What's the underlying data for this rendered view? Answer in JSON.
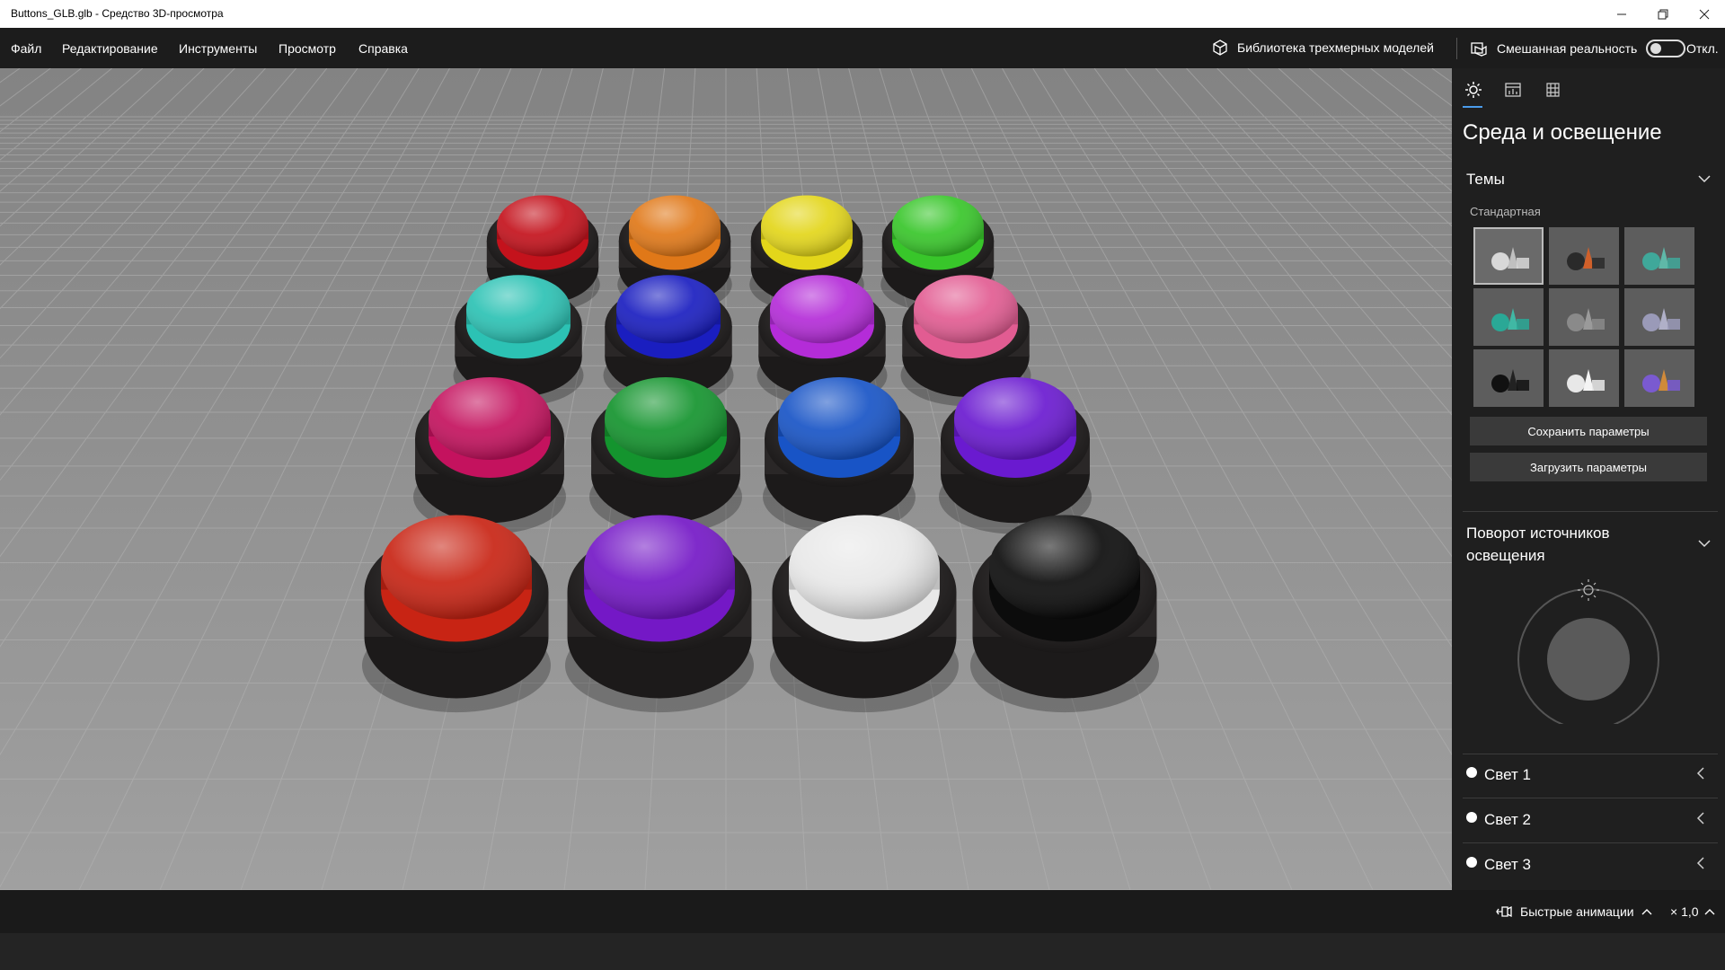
{
  "window": {
    "title": "Buttons_GLB.glb - Средство 3D-просмотра",
    "minimize_icon": "minimize-icon",
    "restore_icon": "restore-icon",
    "close_icon": "close-icon"
  },
  "menu": {
    "items": [
      "Файл",
      "Редактирование",
      "Инструменты",
      "Просмотр",
      "Справка"
    ],
    "library_label": "Библиотека трехмерных моделей",
    "mixed_reality_label": "Смешанная реальность",
    "mixed_reality_state": "Откл."
  },
  "panel": {
    "title": "Среда и освещение",
    "themes": {
      "heading": "Темы",
      "subheading": "Стандартная"
    },
    "save_button": "Сохранить параметры",
    "load_button": "Загрузить параметры",
    "rotation_heading": "Поворот источников освещения",
    "lights": [
      {
        "label": "Свет 1"
      },
      {
        "label": "Свет 2"
      },
      {
        "label": "Свет 3"
      }
    ]
  },
  "status": {
    "animations_label": "Быстрые анимации",
    "speed": "× 1,0"
  },
  "scene": {
    "buttons": [
      {
        "color": "#c4121c"
      },
      {
        "color": "#e07818"
      },
      {
        "color": "#e3d61a"
      },
      {
        "color": "#38c62a"
      },
      {
        "color": "#2cc2b4"
      },
      {
        "color": "#1a1ec0"
      },
      {
        "color": "#b42cd8"
      },
      {
        "color": "#e25c92"
      },
      {
        "color": "#c4125e"
      },
      {
        "color": "#14942e"
      },
      {
        "color": "#1854c6"
      },
      {
        "color": "#6a1ad0"
      },
      {
        "color": "#c82414"
      },
      {
        "color": "#7418c6"
      },
      {
        "color": "#e8e8e8"
      },
      {
        "color": "#0c0c0c"
      }
    ]
  }
}
